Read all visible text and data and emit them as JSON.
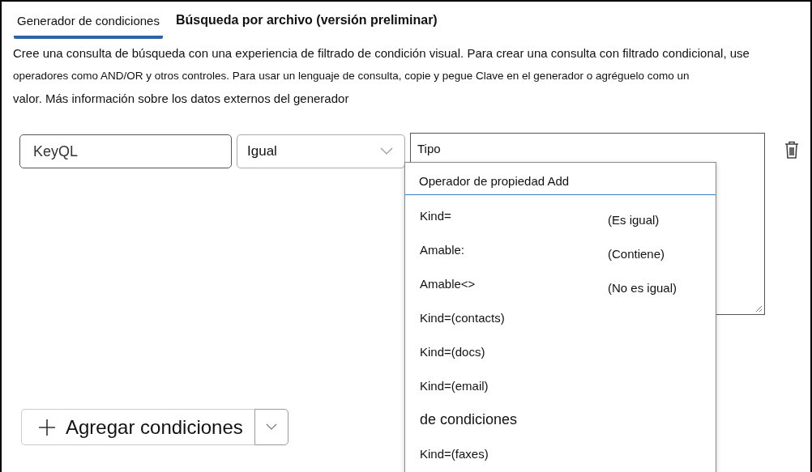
{
  "tabs": [
    {
      "label": "Generador de condiciones",
      "selected": true
    },
    {
      "label": "Búsqueda por archivo (versión preliminar)",
      "selected": false
    }
  ],
  "description": [
    "Cree una consulta de búsqueda con una experiencia de filtrado de condición visual. Para crear una consulta con filtrado condicional, use",
    "operadores como AND/OR y otros controles. Para usar un lenguaje de consulta, copie y pegue Clave en el generador o agréguelo como un",
    "valor. Más información sobre los datos externos del generador"
  ],
  "condition": {
    "property": "KeyQL",
    "operator": "Igual",
    "value": "Tipo"
  },
  "dropdown": {
    "header": "Operador de propiedad Add",
    "items": [
      {
        "kind": "option",
        "label": "Kind=",
        "description": "(Es igual)"
      },
      {
        "kind": "option",
        "label": "Amable:",
        "description": "(Contiene)"
      },
      {
        "kind": "option",
        "label": "Amable<>",
        "description": "(No es igual)"
      },
      {
        "kind": "option",
        "label": "Kind=(contacts)"
      },
      {
        "kind": "option",
        "label": "Kind=(docs)"
      },
      {
        "kind": "option",
        "label": "Kind=(email)"
      },
      {
        "kind": "heading",
        "label": "de condiciones"
      },
      {
        "kind": "option",
        "label": "Kind=(faxes)"
      }
    ]
  },
  "add_button": {
    "label": "Agregar condiciones"
  }
}
